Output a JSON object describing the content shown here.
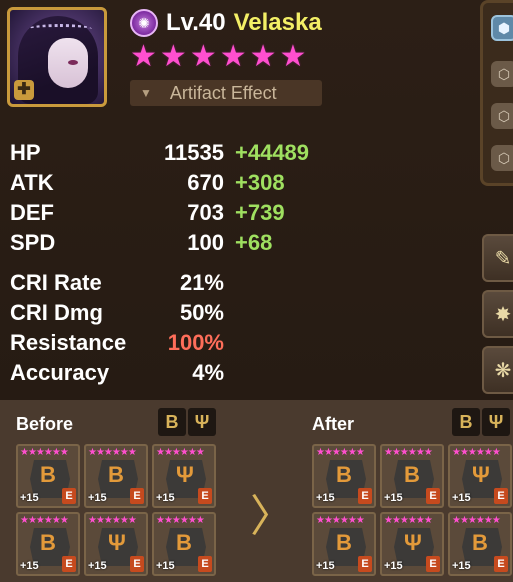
{
  "hero": {
    "element_icon": "dark-element-icon",
    "level": "Lv.40",
    "name": "Velaska",
    "star_count": 6,
    "artifact_label": "Artifact Effect"
  },
  "stats": [
    {
      "label": "HP",
      "value": "11535",
      "bonus": "+44489"
    },
    {
      "label": "ATK",
      "value": "670",
      "bonus": "+308"
    },
    {
      "label": "DEF",
      "value": "703",
      "bonus": "+739"
    },
    {
      "label": "SPD",
      "value": "100",
      "bonus": "+68"
    }
  ],
  "substats": [
    {
      "label": "CRI Rate",
      "value": "21%"
    },
    {
      "label": "CRI Dmg",
      "value": "50%"
    },
    {
      "label": "Resistance",
      "value": "100%",
      "highlight": "#ff6e5a"
    },
    {
      "label": "Accuracy",
      "value": "4%"
    }
  ],
  "runes": {
    "before_title": "Before",
    "after_title": "After",
    "set_icons": [
      "rage-set-icon",
      "fight-set-icon"
    ],
    "set_glyphs": [
      "B",
      "Ψ"
    ],
    "divider": "〉",
    "slot_level": "+15",
    "slot_grade": "E",
    "before_glyphs": [
      "B",
      "B",
      "Ψ",
      "B",
      "Ψ",
      "B"
    ],
    "after_glyphs": [
      "B",
      "B",
      "Ψ",
      "B",
      "Ψ",
      "B"
    ]
  },
  "colors": {
    "accent_name": "#f3ef66",
    "stars": "#ff4fcf",
    "bonus": "#9fe060",
    "highlight_red": "#ff6e5a"
  }
}
